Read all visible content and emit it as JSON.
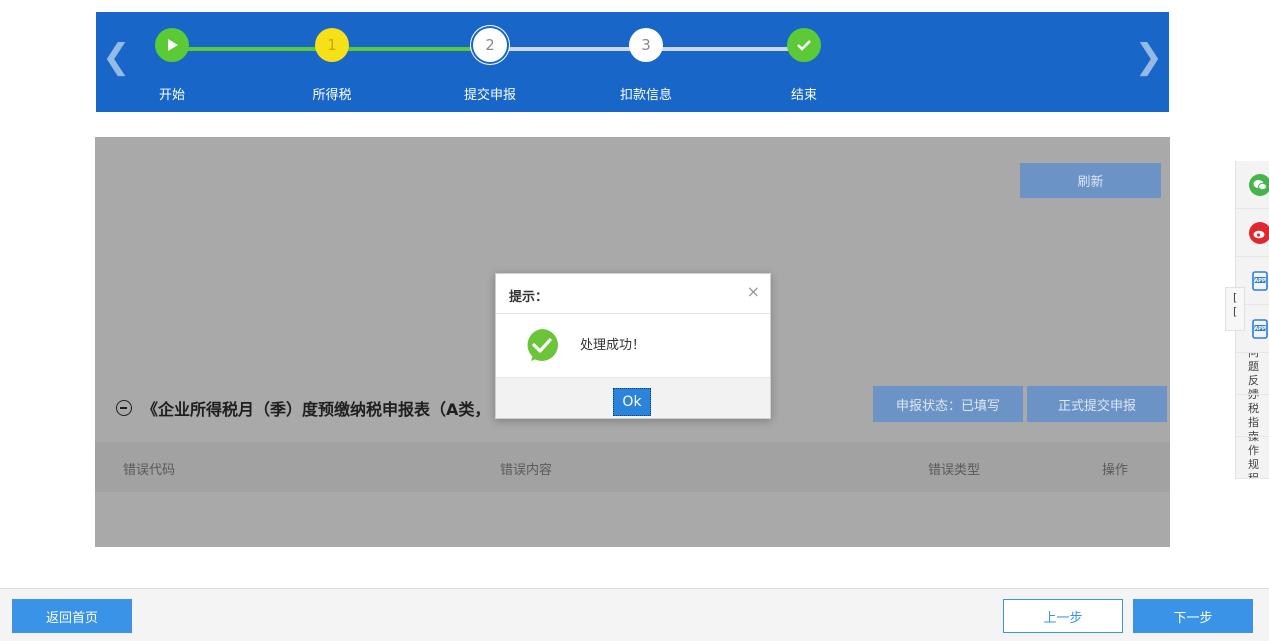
{
  "stepper": {
    "steps": [
      {
        "number": "",
        "label": "开始",
        "state": "done"
      },
      {
        "number": "1",
        "label": "所得税",
        "state": "done"
      },
      {
        "number": "2",
        "label": "提交申报",
        "state": "current"
      },
      {
        "number": "3",
        "label": "扣款信息",
        "state": "pending"
      },
      {
        "number": "",
        "label": "结束",
        "state": "done"
      }
    ],
    "colors": {
      "banner": "#1766c8",
      "done": "#5cc936",
      "current_marker": "#f6e017"
    }
  },
  "panel": {
    "refresh_label": "刷新",
    "form_title": "《企业所得税月（季）度预缴纳税申报表（A类，",
    "status_label": "申报状态：已填写",
    "submit_label": "正式提交申报",
    "table_headers": [
      "错误代码",
      "错误内容",
      "错误类型",
      "操作"
    ]
  },
  "modal": {
    "title": "提示：",
    "close": "×",
    "message": "处理成功！",
    "ok_label": "Ok",
    "icon": "success-check-icon"
  },
  "sidebar": {
    "icons": [
      "wechat-icon",
      "weibo-icon",
      "app-icon",
      "app-icon"
    ],
    "icon_app_text": "APP",
    "items": [
      "问题\n反馈",
      "办税\n指南",
      "操作\n规程"
    ],
    "peek_text": "[ \n[ "
  },
  "footer": {
    "back_home": "返回首页",
    "prev": "上一步",
    "next": "下一步"
  }
}
